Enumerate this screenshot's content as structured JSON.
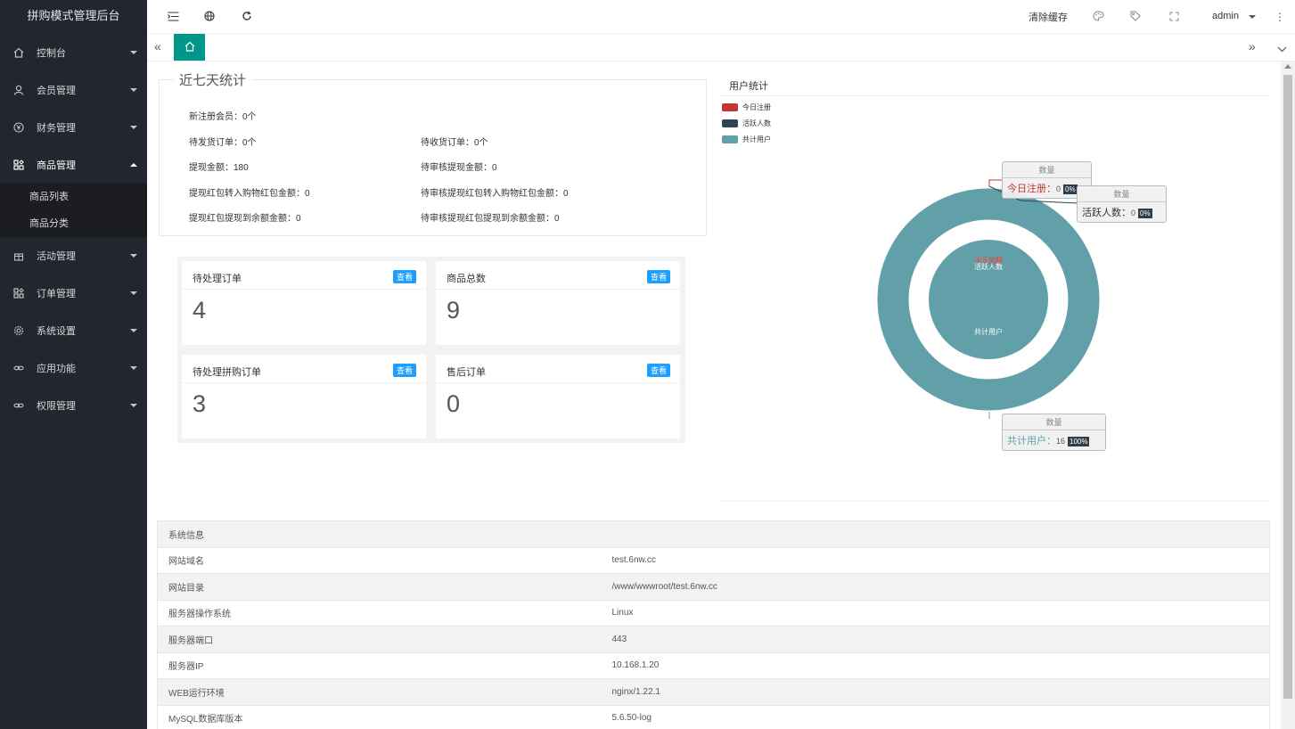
{
  "app_title": "拼购模式管理后台",
  "sidebar": {
    "items": [
      {
        "label": "控制台",
        "icon": "home-icon"
      },
      {
        "label": "会员管理",
        "icon": "user-icon"
      },
      {
        "label": "财务管理",
        "icon": "yen-icon"
      },
      {
        "label": "商品管理",
        "icon": "app-icon",
        "open": true,
        "children": [
          "商品列表",
          "商品分类"
        ]
      },
      {
        "label": "活动管理",
        "icon": "gift-icon"
      },
      {
        "label": "订单管理",
        "icon": "app-icon"
      },
      {
        "label": "系统设置",
        "icon": "gear-icon"
      },
      {
        "label": "应用功能",
        "icon": "link-icon"
      },
      {
        "label": "权限管理",
        "icon": "link-icon"
      }
    ]
  },
  "header": {
    "clear_cache": "清除缓存",
    "user": "admin",
    "more": "⋮"
  },
  "stats": {
    "legend": "近七天统计",
    "rows": [
      [
        "新注册会员：0个",
        ""
      ],
      [
        "待发货订单：0个",
        "待收货订单：0个"
      ],
      [
        "提现金额：180",
        "待审核提现金额：0"
      ],
      [
        "提现红包转入购物红包金额：0",
        "待审核提现红包转入购物红包金额：0"
      ],
      [
        "提现红包提现到余额金额：0",
        "待审核提现红包提现到余额金额：0"
      ]
    ]
  },
  "cards": [
    {
      "title": "待处理订单",
      "btn": "查看",
      "value": "4"
    },
    {
      "title": "商品总数",
      "btn": "查看",
      "value": "9"
    },
    {
      "title": "待处理拼购订单",
      "btn": "查看",
      "value": "3"
    },
    {
      "title": "售后订单",
      "btn": "查看",
      "value": "0"
    }
  ],
  "chart": {
    "title": "用户统计",
    "legend": [
      {
        "name": "今日注册",
        "color": "#c23531"
      },
      {
        "name": "活跃人数",
        "color": "#2f4554"
      },
      {
        "name": "共计用户",
        "color": "#61a0a8"
      }
    ],
    "inner_labels": [
      "今日注册",
      "活跃人数",
      "共计用户"
    ],
    "tooltips": [
      {
        "head": "数量",
        "label": "今日注册：",
        "value": "0",
        "pct": "0%",
        "color": "#c23531"
      },
      {
        "head": "数量",
        "label": "活跃人数：",
        "value": "0",
        "pct": "0%",
        "color": "#333333"
      },
      {
        "head": "数量",
        "label": "共计用户：",
        "value": "16",
        "pct": "100%",
        "color": "#61a0a8"
      }
    ]
  },
  "chart_data": {
    "type": "pie",
    "title": "用户统计",
    "categories": [
      "今日注册",
      "活跃人数",
      "共计用户"
    ],
    "values": [
      0,
      0,
      16
    ],
    "series": [
      {
        "name": "数量",
        "values": [
          0,
          0,
          16
        ]
      }
    ],
    "legend": "top-left"
  },
  "sysinfo": {
    "title": "系统信息",
    "rows": [
      [
        "网站域名",
        "test.6nw.cc"
      ],
      [
        "网站目录",
        "/www/wwwroot/test.6nw.cc"
      ],
      [
        "服务器操作系统",
        "Linux"
      ],
      [
        "服务器端口",
        "443"
      ],
      [
        "服务器IP",
        "10.168.1.20"
      ],
      [
        "WEB运行环境",
        "nginx/1.22.1"
      ],
      [
        "MySQL数据库版本",
        "5.6.50-log"
      ]
    ]
  }
}
